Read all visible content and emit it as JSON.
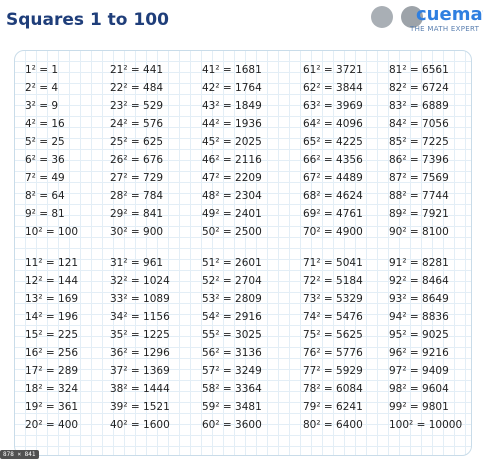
{
  "header": {
    "title": "Squares 1 to 100",
    "logo_text": "cuemath",
    "logo_tagline": "THE MATH EXPERT"
  },
  "table": {
    "columns": [
      [
        "1² = 1",
        "2² = 4",
        "3² = 9",
        "4² = 16",
        "5² = 25",
        "6² = 36",
        "7² = 49",
        "8² = 64",
        "9² = 81",
        "10² = 100",
        "11² = 121",
        "12² = 144",
        "13² = 169",
        "14² = 196",
        "15² = 225",
        "16² = 256",
        "17² = 289",
        "18² = 324",
        "19² = 361",
        "20² = 400"
      ],
      [
        "21² = 441",
        "22² = 484",
        "23² = 529",
        "24² = 576",
        "25² = 625",
        "26² = 676",
        "27² = 729",
        "28² = 784",
        "29² = 841",
        "30² = 900",
        "31² = 961",
        "32² = 1024",
        "33² = 1089",
        "34² = 1156",
        "35² = 1225",
        "36² = 1296",
        "37² = 1369",
        "38² = 1444",
        "39² = 1521",
        "40² = 1600"
      ],
      [
        "41² = 1681",
        "42² = 1764",
        "43² = 1849",
        "44² = 1936",
        "45² = 2025",
        "46² = 2116",
        "47² = 2209",
        "48² = 2304",
        "49² = 2401",
        "50² = 2500",
        "51² = 2601",
        "52² = 2704",
        "53² = 2809",
        "54² = 2916",
        "55² = 3025",
        "56² = 3136",
        "57² = 3249",
        "58² = 3364",
        "59² = 3481",
        "60² = 3600"
      ],
      [
        "61² = 3721",
        "62² = 3844",
        "63² = 3969",
        "64² = 4096",
        "65² = 4225",
        "66² = 4356",
        "67² = 4489",
        "68² = 4624",
        "69² = 4761",
        "70² = 4900",
        "71² = 5041",
        "72² = 5184",
        "73² = 5329",
        "74² = 5476",
        "75² = 5625",
        "76² = 5776",
        "77² = 5929",
        "78² = 6084",
        "79² = 6241",
        "80² = 6400"
      ],
      [
        "81² = 6561",
        "82² = 6724",
        "83² = 6889",
        "84² = 7056",
        "85² = 7225",
        "86² = 7396",
        "87² = 7569",
        "88² = 7744",
        "89² = 7921",
        "90² = 8100",
        "91² = 8281",
        "92² = 8464",
        "93² = 8649",
        "94² = 8836",
        "95² = 9025",
        "96² = 9216",
        "97² = 9409",
        "98² = 9604",
        "99² = 9801",
        "100² = 10000"
      ]
    ]
  },
  "footer": {
    "size_badge": "878 × 841"
  }
}
